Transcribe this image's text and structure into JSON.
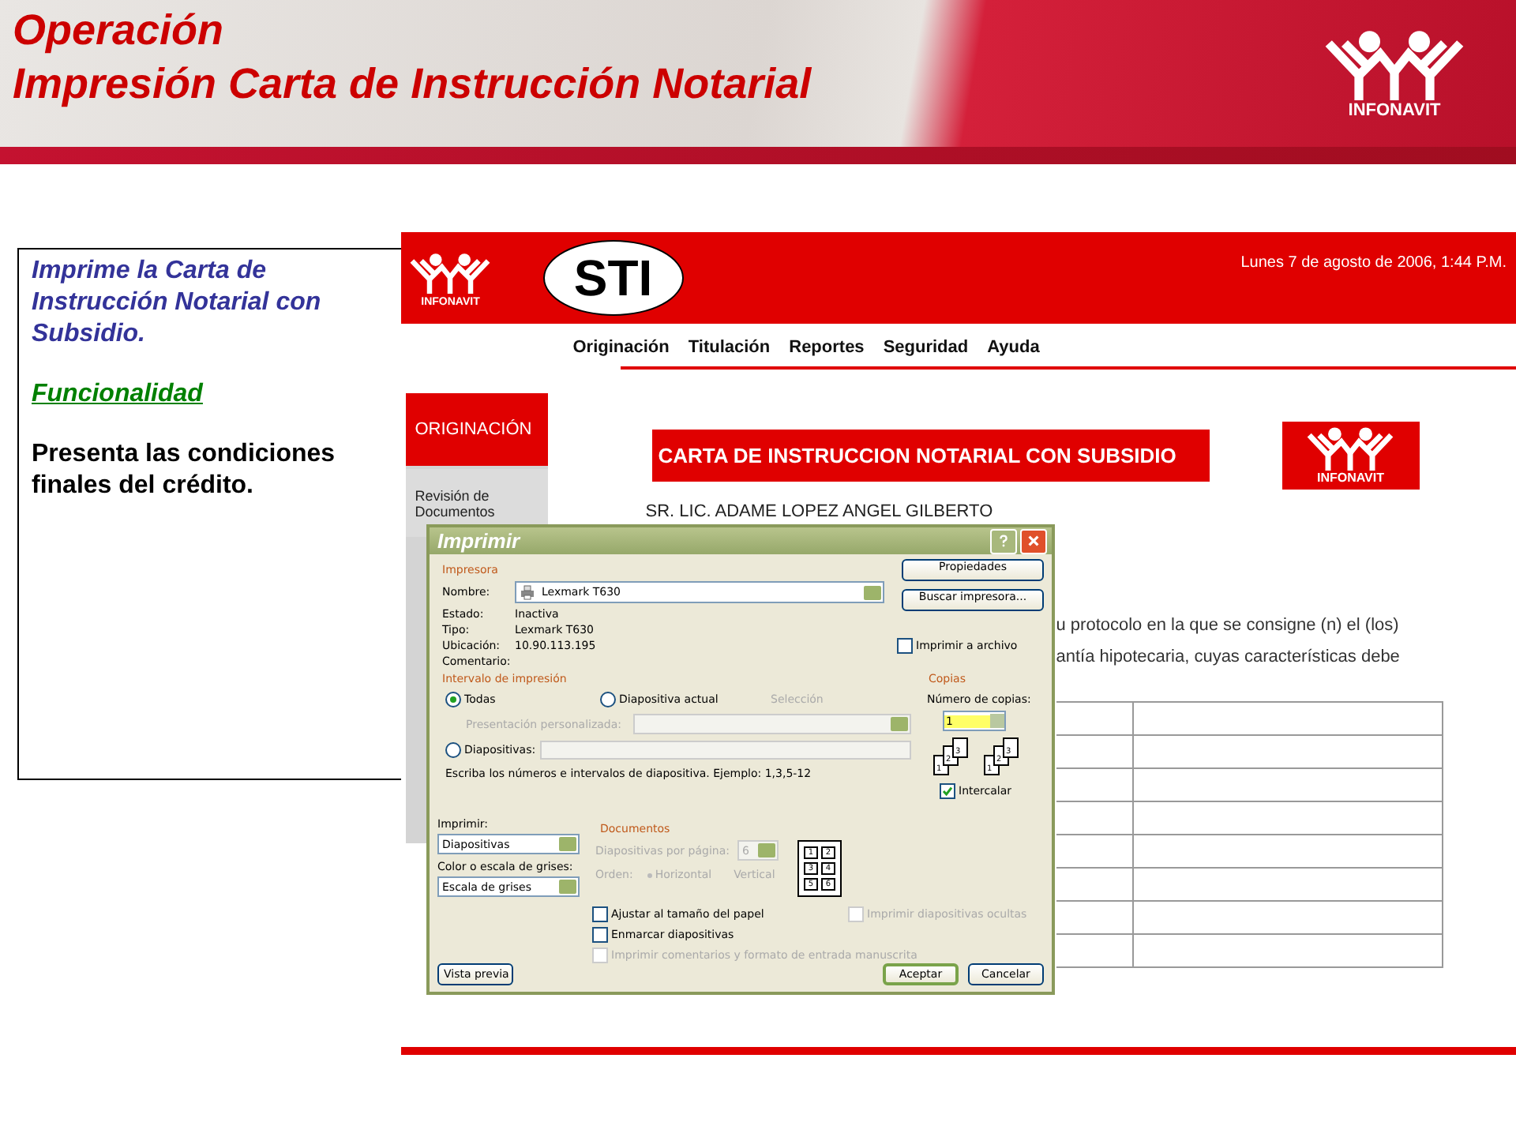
{
  "slide": {
    "title_lines": [
      "Operación",
      "Impresión Carta de Instrucción Notarial"
    ],
    "logo_text": "INFONAVIT"
  },
  "notes": {
    "intro": "Imprime la Carta de Instrucción Notarial con Subsidio.",
    "heading": "Funcionalidad",
    "body": "Presenta las condiciones finales del crédito."
  },
  "app": {
    "logo_text": "INFONAVIT",
    "brand": "STI",
    "datetime": "Lunes 7 de agosto de 2006, 1:44 P.M.",
    "menu": [
      "Originación",
      "Titulación",
      "Reportes",
      "Seguridad",
      "Ayuda"
    ],
    "sidebar": {
      "items": [
        {
          "label": "ORIGINACIÓN",
          "selected": true
        },
        {
          "label": "Revisión de Documentos",
          "selected": false
        }
      ]
    },
    "document": {
      "title": "CARTA DE INSTRUCCION NOTARIAL CON SUBSIDIO",
      "logo_text": "INFONAVIT",
      "addressee": "SR. LIC. ADAME LOPEZ ANGEL GILBERTO",
      "paragraph_lines": [
        "u protocolo en la que se consigne (n) el (los)",
        "antía hipotecaria, cuyas características debe"
      ]
    }
  },
  "dialog": {
    "title": "Imprimir",
    "printer": {
      "section": "Impresora",
      "name_label": "Nombre:",
      "name_value": "Lexmark T630",
      "info": [
        {
          "label": "Estado:",
          "value": "Inactiva"
        },
        {
          "label": "Tipo:",
          "value": "Lexmark T630"
        },
        {
          "label": "Ubicación:",
          "value": "10.90.113.195"
        },
        {
          "label": "Comentario:"
        }
      ]
    },
    "side_buttons": [
      "Propiedades",
      "Buscar impresora..."
    ],
    "print_to_file": {
      "label": "Imprimir a archivo",
      "checked": false
    },
    "range": {
      "section": "Intervalo de impresión",
      "all": {
        "label": "Todas",
        "selected": true
      },
      "current": {
        "label": "Diapositiva actual",
        "selected": false
      },
      "selection": {
        "label": "Selección",
        "disabled": true
      },
      "custom": {
        "label": "Presentación personalizada:",
        "disabled": true
      },
      "slides": {
        "label": "Diapositivas:",
        "selected": false
      },
      "hint": "Escriba los números e intervalos de diapositiva. Ejemplo: 1,3,5-12"
    },
    "copies": {
      "section": "Copias",
      "label": "Número de copias:",
      "value": "1",
      "stacks": [
        [
          "1",
          "2",
          "3"
        ],
        [
          "1",
          "2",
          "3"
        ]
      ],
      "collate": {
        "label": "Intercalar",
        "checked": true
      }
    },
    "print_what": {
      "label": "Imprimir:",
      "value": "Diapositivas"
    },
    "color": {
      "label": "Color o escala de grises:",
      "value": "Escala de grises"
    },
    "handouts": {
      "section": "Documentos",
      "per_page_label": "Diapositivas por página:",
      "per_page_value": "6",
      "order_label": "Orden:",
      "orders": [
        {
          "label": "Horizontal",
          "selected": true
        },
        {
          "label": "Vertical",
          "selected": false
        }
      ],
      "preview": [
        "1",
        "2",
        "3",
        "4",
        "5",
        "6"
      ],
      "disabled": true
    },
    "options": [
      {
        "label": "Ajustar al tamaño del papel",
        "checked": false,
        "disabled": false
      },
      {
        "label": "Enmarcar diapositivas",
        "checked": false,
        "disabled": false
      },
      {
        "label": "Imprimir comentarios y formato de entrada manuscrita",
        "checked": false,
        "disabled": true
      }
    ],
    "hidden_slides": {
      "label": "Imprimir diapositivas ocultas",
      "checked": false,
      "disabled": true
    },
    "footer": {
      "preview": "Vista previa",
      "ok": "Aceptar",
      "cancel": "Cancelar"
    }
  }
}
